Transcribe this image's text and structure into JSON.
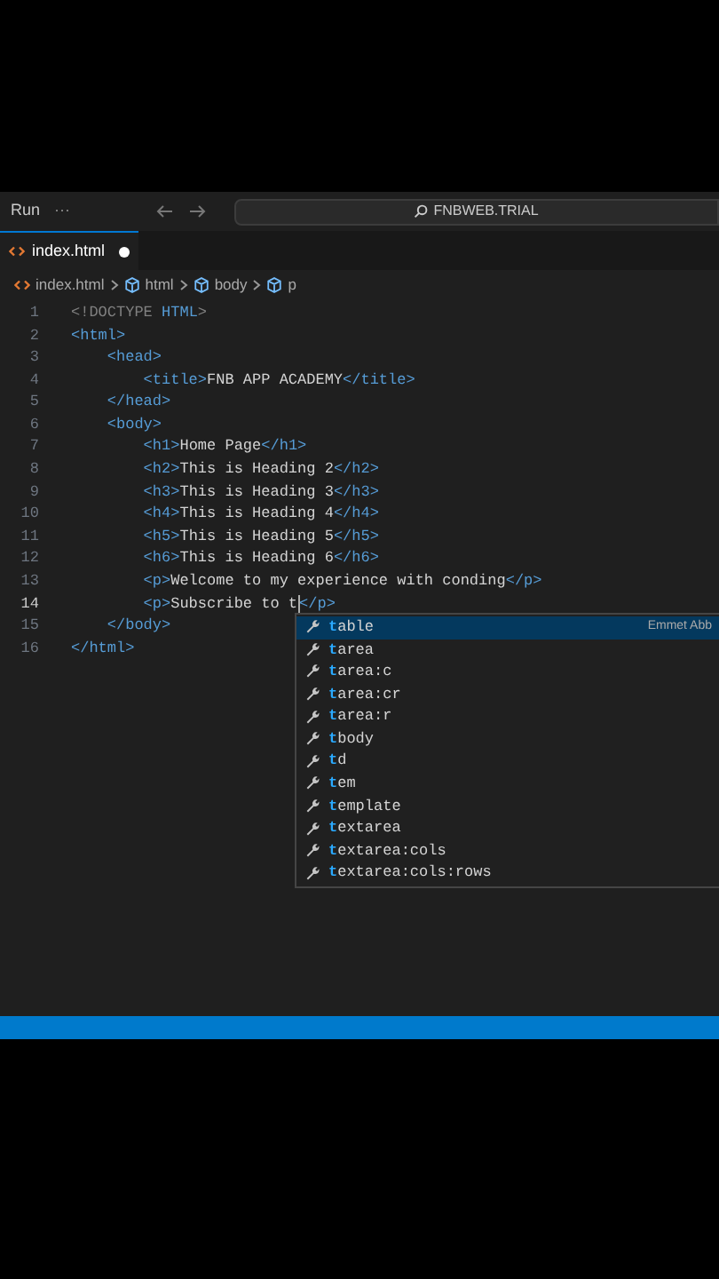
{
  "titlebar": {
    "menu": "Run",
    "more": "···",
    "search": "FNBWEB.TRIAL"
  },
  "tabs": [
    {
      "label": "index.html",
      "selected": true,
      "dirty": true
    }
  ],
  "breadcrumb": [
    {
      "label": "index.html",
      "kind": "file"
    },
    {
      "label": "html",
      "kind": "element"
    },
    {
      "label": "body",
      "kind": "element"
    },
    {
      "label": "p",
      "kind": "element"
    }
  ],
  "lines": [
    {
      "number": "1",
      "active": false,
      "segments": [
        {
          "kind": "punct",
          "text": "<!DOCTYPE "
        },
        {
          "kind": "keyword",
          "text": "HTML"
        },
        {
          "kind": "punct",
          "text": ">"
        }
      ]
    },
    {
      "number": "2",
      "active": false,
      "segments": [
        {
          "kind": "tag",
          "text": "<html>"
        }
      ]
    },
    {
      "number": "3",
      "active": false,
      "segments": [
        {
          "kind": "tag",
          "text": "    <head>"
        }
      ]
    },
    {
      "number": "4",
      "active": false,
      "segments": [
        {
          "kind": "tag",
          "text": "        <title>"
        },
        {
          "kind": "text",
          "text": "FNB APP ACADEMY"
        },
        {
          "kind": "tag",
          "text": "</title>"
        }
      ]
    },
    {
      "number": "5",
      "active": false,
      "segments": [
        {
          "kind": "tag",
          "text": "    </head>"
        }
      ]
    },
    {
      "number": "6",
      "active": false,
      "segments": [
        {
          "kind": "tag",
          "text": "    <body>"
        }
      ]
    },
    {
      "number": "7",
      "active": false,
      "segments": [
        {
          "kind": "tag",
          "text": "        <h1>"
        },
        {
          "kind": "text",
          "text": "Home Page"
        },
        {
          "kind": "tag",
          "text": "</h1>"
        }
      ]
    },
    {
      "number": "8",
      "active": false,
      "segments": [
        {
          "kind": "tag",
          "text": "        <h2>"
        },
        {
          "kind": "text",
          "text": "This is Heading 2"
        },
        {
          "kind": "tag",
          "text": "</h2>"
        }
      ]
    },
    {
      "number": "9",
      "active": false,
      "segments": [
        {
          "kind": "tag",
          "text": "        <h3>"
        },
        {
          "kind": "text",
          "text": "This is Heading 3"
        },
        {
          "kind": "tag",
          "text": "</h3>"
        }
      ]
    },
    {
      "number": "10",
      "active": false,
      "segments": [
        {
          "kind": "tag",
          "text": "        <h4>"
        },
        {
          "kind": "text",
          "text": "This is Heading 4"
        },
        {
          "kind": "tag",
          "text": "</h4>"
        }
      ]
    },
    {
      "number": "11",
      "active": false,
      "segments": [
        {
          "kind": "tag",
          "text": "        <h5>"
        },
        {
          "kind": "text",
          "text": "This is Heading 5"
        },
        {
          "kind": "tag",
          "text": "</h5>"
        }
      ]
    },
    {
      "number": "12",
      "active": false,
      "segments": [
        {
          "kind": "tag",
          "text": "        <h6>"
        },
        {
          "kind": "text",
          "text": "This is Heading 6"
        },
        {
          "kind": "tag",
          "text": "</h6>"
        }
      ]
    },
    {
      "number": "13",
      "active": false,
      "segments": [
        {
          "kind": "tag",
          "text": "        <p>"
        },
        {
          "kind": "text",
          "text": "Welcome to my experience with conding"
        },
        {
          "kind": "tag",
          "text": "</p>"
        }
      ]
    },
    {
      "number": "14",
      "active": true,
      "segments": [
        {
          "kind": "tag",
          "text": "        <p>"
        },
        {
          "kind": "text",
          "text": "Subscribe to t"
        },
        {
          "kind": "caret"
        },
        {
          "kind": "tag",
          "text": "</p>"
        }
      ]
    },
    {
      "number": "15",
      "active": false,
      "segments": [
        {
          "kind": "tag",
          "text": "    </body>"
        }
      ]
    },
    {
      "number": "16",
      "active": false,
      "segments": [
        {
          "kind": "tag",
          "text": "</html>"
        }
      ]
    }
  ],
  "suggestions": [
    {
      "match": "t",
      "rest": "able",
      "selected": true,
      "detail": "Emmet Abb"
    },
    {
      "match": "t",
      "rest": "area",
      "selected": false
    },
    {
      "match": "t",
      "rest": "area:c",
      "selected": false
    },
    {
      "match": "t",
      "rest": "area:cr",
      "selected": false
    },
    {
      "match": "t",
      "rest": "area:r",
      "selected": false
    },
    {
      "match": "t",
      "rest": "body",
      "selected": false
    },
    {
      "match": "t",
      "rest": "d",
      "selected": false
    },
    {
      "match": "t",
      "rest": "em",
      "selected": false
    },
    {
      "match": "t",
      "rest": "emplate",
      "selected": false
    },
    {
      "match": "t",
      "rest": "extarea",
      "selected": false
    },
    {
      "match": "t",
      "rest": "extarea:cols",
      "selected": false
    },
    {
      "match": "t",
      "rest": "extarea:cols:rows",
      "selected": false
    }
  ]
}
